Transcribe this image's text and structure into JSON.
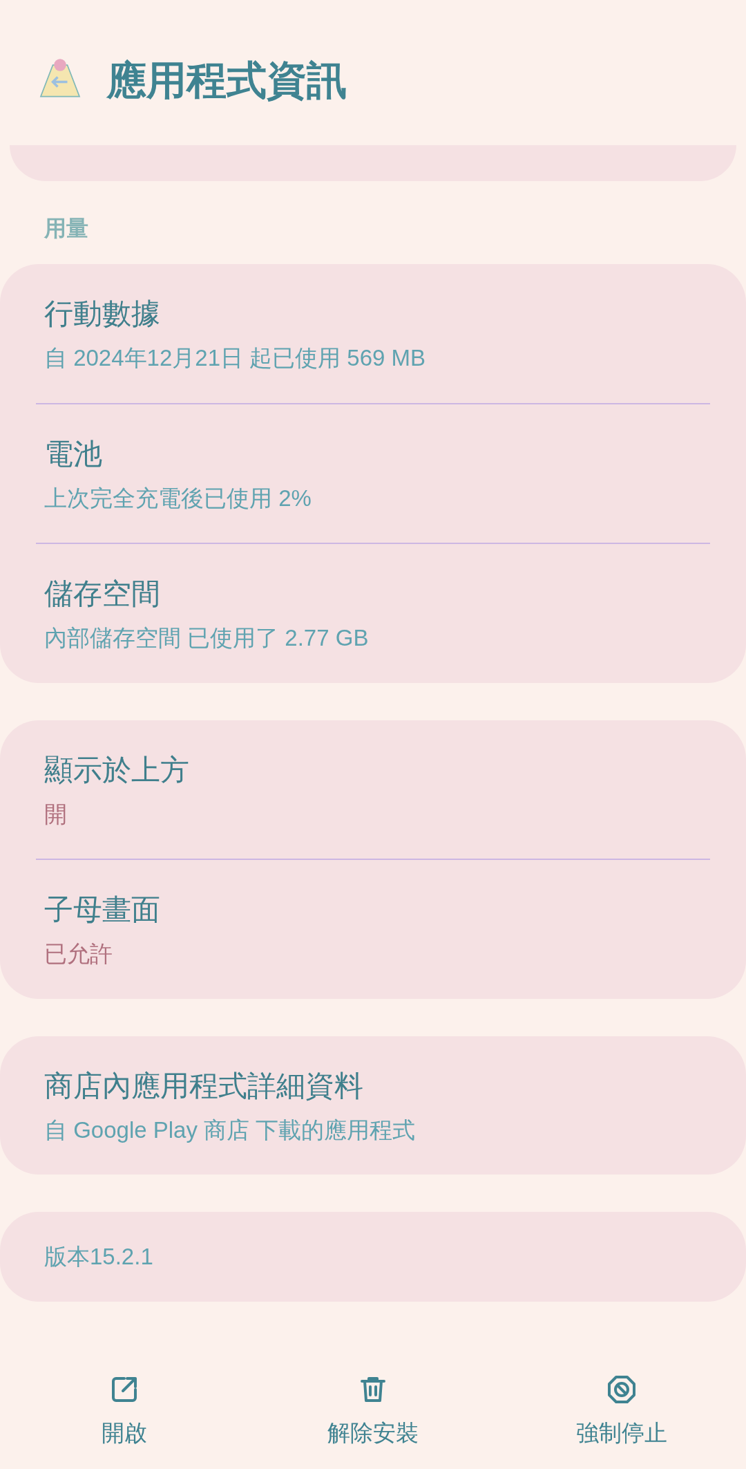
{
  "header": {
    "title": "應用程式資訊"
  },
  "sections": [
    {
      "heading": "用量",
      "items": [
        {
          "title": "行動數據",
          "subtitle": "自 2024年12月21日 起已使用 569 MB",
          "kind": "info"
        },
        {
          "title": "電池",
          "subtitle": "上次完全充電後已使用 2%",
          "kind": "info"
        },
        {
          "title": "儲存空間",
          "subtitle": "內部儲存空間 已使用了 2.77 GB",
          "kind": "info"
        }
      ]
    },
    {
      "items": [
        {
          "title": "顯示於上方",
          "subtitle": "開",
          "kind": "status"
        },
        {
          "title": "子母畫面",
          "subtitle": "已允許",
          "kind": "status"
        }
      ]
    },
    {
      "items": [
        {
          "title": "商店內應用程式詳細資料",
          "subtitle": "自 Google Play 商店 下載的應用程式",
          "kind": "info"
        }
      ]
    },
    {
      "items": [
        {
          "subtitle": "版本15.2.1",
          "kind": "info"
        }
      ]
    }
  ],
  "actions": [
    {
      "label": "開啟",
      "kind": "open"
    },
    {
      "label": "解除安裝",
      "kind": "trash"
    },
    {
      "label": "強制停止",
      "kind": "stop"
    }
  ]
}
